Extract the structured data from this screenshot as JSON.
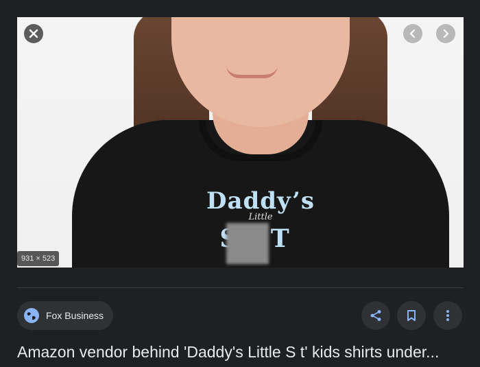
{
  "image": {
    "dimensions_label": "931 × 523",
    "shirt_line1": "Daddy’s",
    "shirt_line2": "Little",
    "shirt_line3": "S T"
  },
  "controls": {
    "close_icon": "close-icon",
    "prev_icon": "chevron-left-icon",
    "next_icon": "chevron-right-icon"
  },
  "source": {
    "name": "Fox Business",
    "icon": "globe-icon"
  },
  "actions": {
    "share_icon": "share-icon",
    "save_icon": "bookmark-icon",
    "more_icon": "more-vertical-icon"
  },
  "headline": "Amazon vendor behind 'Daddy's Little S  t' kids shirts under...",
  "colors": {
    "background": "#1f2024",
    "chip": "#303134",
    "accent": "#8ab4f8",
    "text": "#e8eaed"
  }
}
